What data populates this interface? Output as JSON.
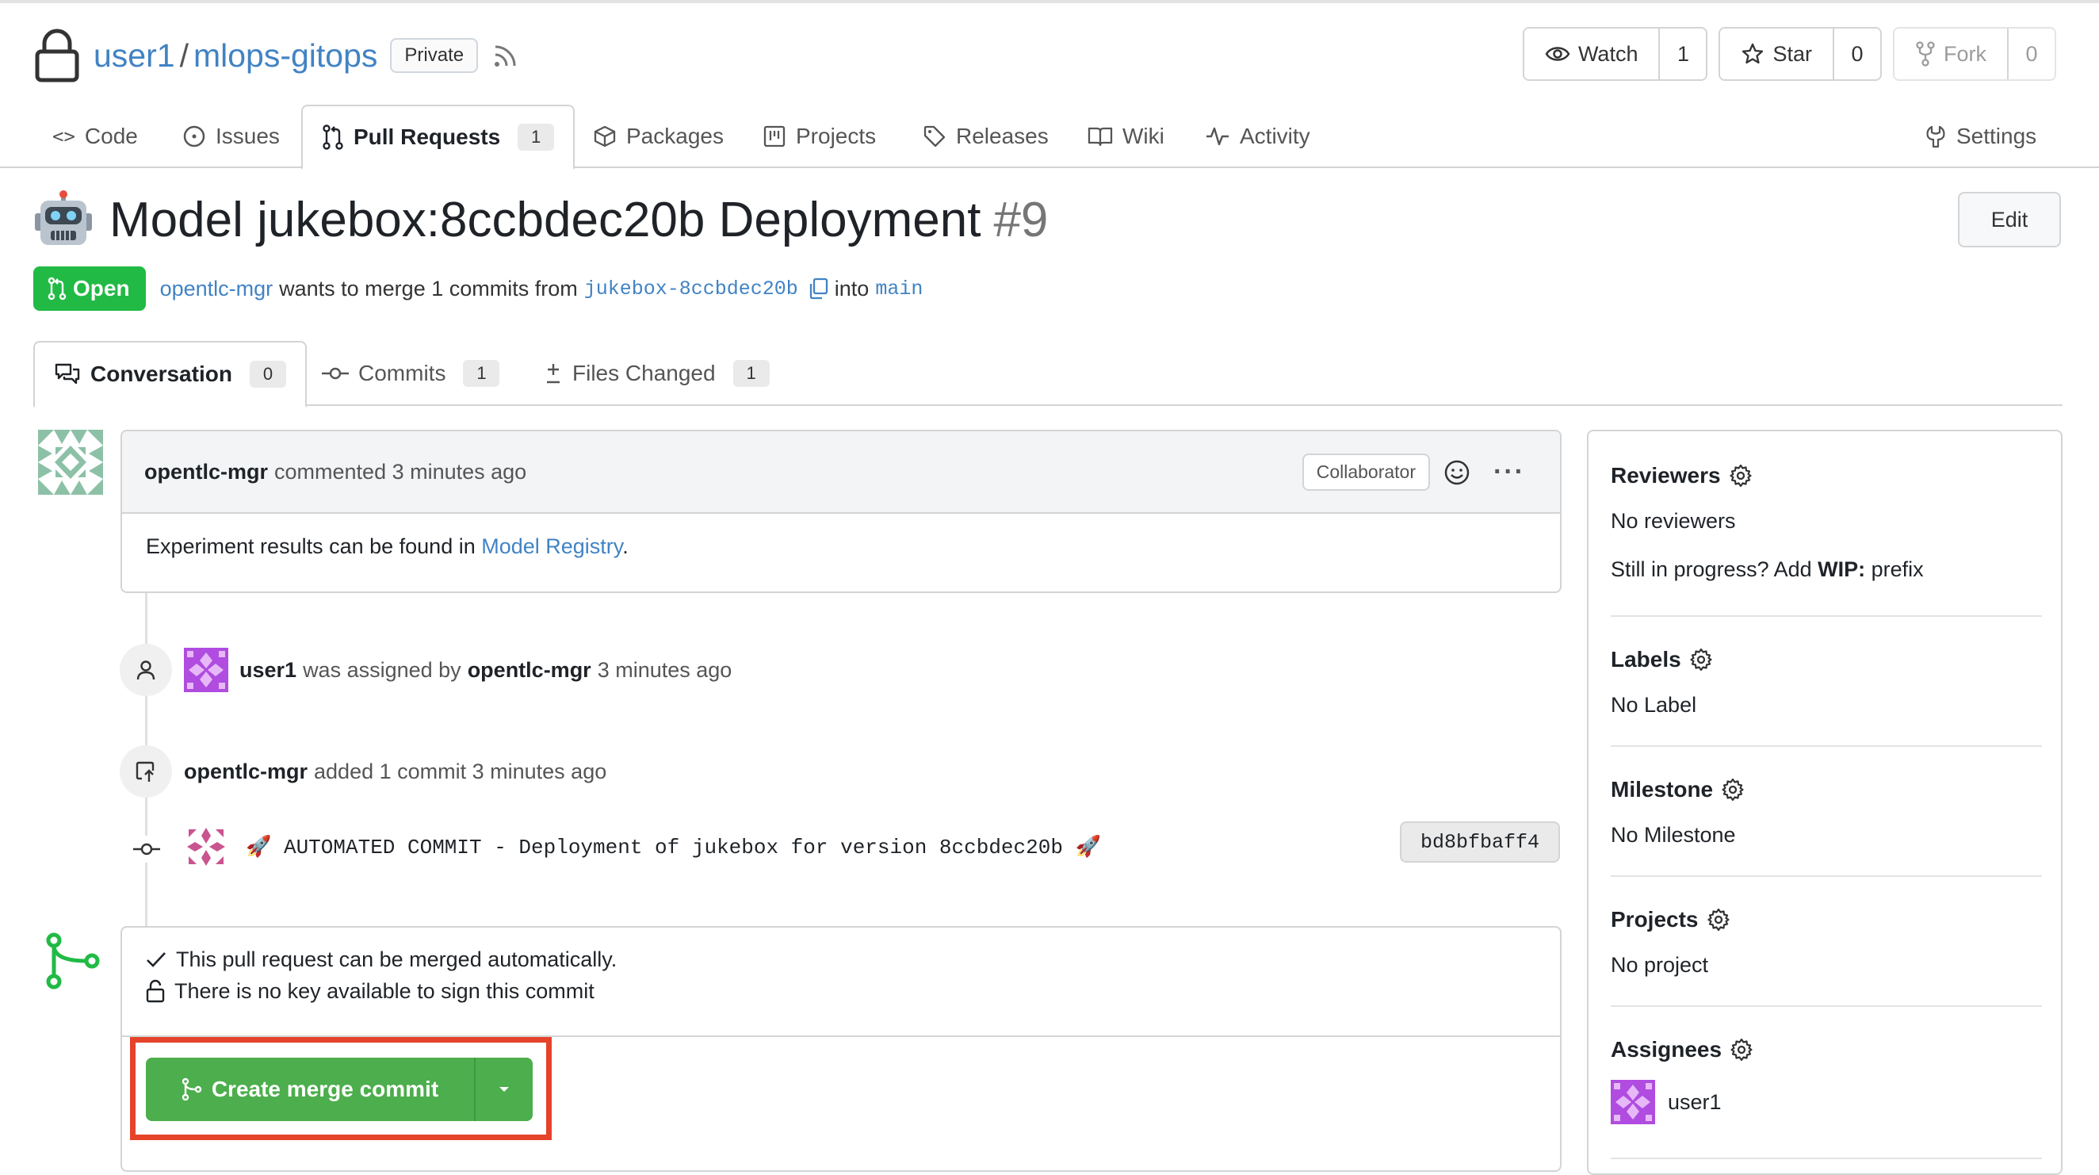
{
  "repo": {
    "owner": "user1",
    "separator": "/",
    "name": "mlops-gitops",
    "visibility": "Private",
    "actions": {
      "watch_label": "Watch",
      "watch_count": "1",
      "star_label": "Star",
      "star_count": "0",
      "fork_label": "Fork",
      "fork_count": "0"
    }
  },
  "nav": {
    "code": "Code",
    "issues": "Issues",
    "pull_requests": "Pull Requests",
    "pull_requests_count": "1",
    "packages": "Packages",
    "projects": "Projects",
    "releases": "Releases",
    "wiki": "Wiki",
    "activity": "Activity",
    "settings": "Settings"
  },
  "pr": {
    "title": "Model jukebox:8ccbdec20b Deployment",
    "number": "#9",
    "edit_label": "Edit",
    "state": "Open",
    "author": "opentlc-mgr",
    "merge_text": "wants to merge 1 commits from",
    "head_branch": "jukebox-8ccbdec20b",
    "into_text": "into",
    "base_branch": "main"
  },
  "tabs": {
    "conversation": "Conversation",
    "conversation_count": "0",
    "commits": "Commits",
    "commits_count": "1",
    "files": "Files Changed",
    "files_count": "1"
  },
  "comment": {
    "author": "opentlc-mgr",
    "meta": "commented 3 minutes ago",
    "role": "Collaborator",
    "more": "···",
    "body_prefix": "Experiment results can be found in ",
    "body_link": "Model Registry",
    "body_suffix": "."
  },
  "events": {
    "assigned": {
      "user": "user1",
      "text": "was assigned by",
      "by": "opentlc-mgr",
      "time": "3 minutes ago"
    },
    "commits_added": {
      "user": "opentlc-mgr",
      "text": "added 1 commit 3 minutes ago"
    },
    "commit": {
      "message": "🚀 AUTOMATED COMMIT - Deployment of jukebox for version 8ccbdec20b 🚀",
      "sha": "bd8bfbaff4"
    }
  },
  "merge": {
    "status_mergeable": "This pull request can be merged automatically.",
    "status_signing": "There is no key available to sign this commit",
    "button_label": "Create merge commit"
  },
  "sidebar": {
    "reviewers_title": "Reviewers",
    "reviewers_value": "No reviewers",
    "wip_prefix": "Still in progress? Add ",
    "wip_tag": "WIP:",
    "wip_suffix": " prefix",
    "labels_title": "Labels",
    "labels_value": "No Label",
    "milestone_title": "Milestone",
    "milestone_value": "No Milestone",
    "projects_title": "Projects",
    "projects_value": "No project",
    "assignees_title": "Assignees",
    "assignee": "user1"
  },
  "colors": {
    "open_green": "#21ba45",
    "merge_green": "#4cae4c",
    "link_blue": "#4183c4",
    "highlight_red": "#e5432a"
  }
}
